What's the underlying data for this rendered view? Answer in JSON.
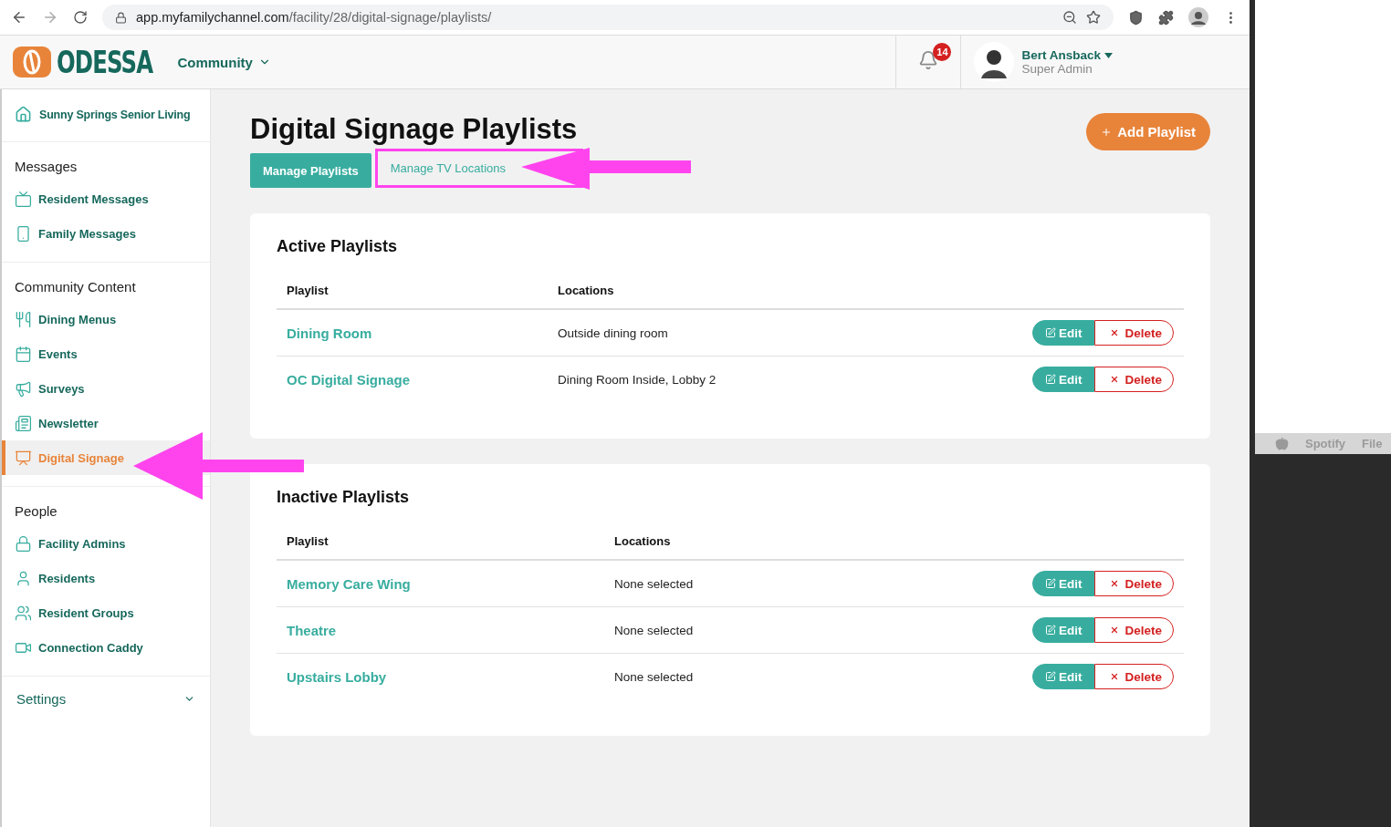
{
  "browser": {
    "url_host": "app.myfamilychannel.com",
    "url_path": "/facility/28/digital-signage/playlists/"
  },
  "header": {
    "logo": "ODESSA",
    "community": "Community",
    "notifications": "14",
    "user": {
      "name": "Bert Ansback",
      "role": "Super Admin"
    }
  },
  "sidebar": {
    "facility": "Sunny Springs Senior Living",
    "sections": [
      {
        "title": "Messages",
        "items": [
          {
            "label": "Resident Messages",
            "selected": false
          },
          {
            "label": "Family Messages",
            "selected": false
          }
        ]
      },
      {
        "title": "Community Content",
        "items": [
          {
            "label": "Dining Menus",
            "selected": false
          },
          {
            "label": "Events",
            "selected": false
          },
          {
            "label": "Surveys",
            "selected": false
          },
          {
            "label": "Newsletter",
            "selected": false
          },
          {
            "label": "Digital Signage",
            "selected": true
          }
        ]
      },
      {
        "title": "People",
        "items": [
          {
            "label": "Facility Admins",
            "selected": false
          },
          {
            "label": "Residents",
            "selected": false
          },
          {
            "label": "Resident Groups",
            "selected": false
          },
          {
            "label": "Connection Caddy",
            "selected": false
          }
        ]
      }
    ],
    "settings": "Settings"
  },
  "page": {
    "title": "Digital Signage Playlists",
    "add_button": "Add Playlist",
    "tabs": [
      {
        "label": "Manage Playlists",
        "selected": true
      },
      {
        "label": "Manage TV Locations",
        "selected": false
      }
    ]
  },
  "tables": [
    {
      "title": "Active Playlists",
      "columns": [
        "Playlist",
        "Locations"
      ],
      "rows": [
        {
          "playlist": "Dining Room",
          "locations": "Outside dining room",
          "edit": "Edit",
          "delete": "Delete"
        },
        {
          "playlist": "OC Digital Signage",
          "locations": "Dining Room Inside, Lobby 2",
          "edit": "Edit",
          "delete": "Delete"
        }
      ]
    },
    {
      "title": "Inactive Playlists",
      "columns": [
        "Playlist",
        "Locations"
      ],
      "rows": [
        {
          "playlist": "Memory Care Wing",
          "locations": "None selected",
          "edit": "Edit",
          "delete": "Delete"
        },
        {
          "playlist": "Theatre",
          "locations": "None selected",
          "edit": "Edit",
          "delete": "Delete"
        },
        {
          "playlist": "Upstairs Lobby",
          "locations": "None selected",
          "edit": "Edit",
          "delete": "Delete"
        }
      ]
    }
  ],
  "desktop_menu": [
    "Spotify",
    "File"
  ]
}
